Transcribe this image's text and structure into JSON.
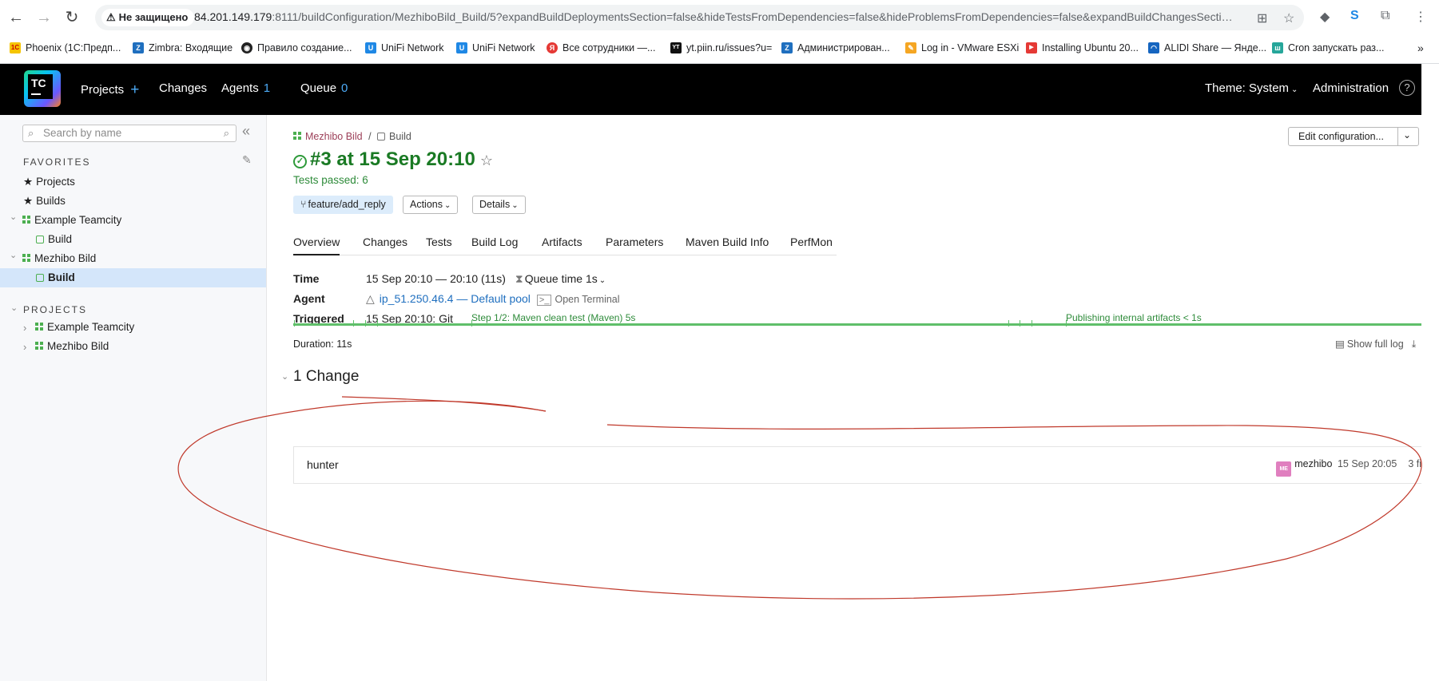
{
  "browser": {
    "insecure_label": "Не защищено",
    "url_host": "84.201.149.179",
    "url_rest": ":8111/buildConfiguration/MezhiboBild_Build/5?expandBuildDeploymentsSection=false&hideTestsFromDependencies=false&hideProblemsFromDependencies=false&expandBuildChangesSection=t...",
    "bookmarks": [
      {
        "label": "Phoenix (1С:Предп...",
        "color": "#f5c400",
        "glyph": "1С"
      },
      {
        "label": "Zimbra: Входящие",
        "color": "#1f6fbf",
        "glyph": "Z"
      },
      {
        "label": "Правило создание...",
        "color": "#222222",
        "glyph": "◉"
      },
      {
        "label": "UniFi Network",
        "color": "#1f88e5",
        "glyph": "U"
      },
      {
        "label": "UniFi Network",
        "color": "#1f88e5",
        "glyph": "U"
      },
      {
        "label": "Все сотрудники —...",
        "color": "#e53935",
        "glyph": "Я"
      },
      {
        "label": "yt.piin.ru/issues?u=",
        "color": "#111111",
        "glyph": "YT"
      },
      {
        "label": "Администрирован...",
        "color": "#1f6fbf",
        "glyph": "Z"
      },
      {
        "label": "Log in - VMware ESXi",
        "color": "#f5a623",
        "glyph": "✎"
      },
      {
        "label": "Installing Ubuntu 20...",
        "color": "#e53935",
        "glyph": "▶"
      },
      {
        "label": "ALIDI Share — Янде...",
        "color": "#1565c0",
        "glyph": "◠"
      },
      {
        "label": "Cron запускать раз...",
        "color": "#26a69a",
        "glyph": "ш"
      }
    ]
  },
  "header": {
    "nav": {
      "projects": "Projects",
      "changes": "Changes",
      "agents": "Agents",
      "agents_count": "1",
      "queue": "Queue",
      "queue_count": "0"
    },
    "theme": "Theme: System",
    "administration": "Administration",
    "logo_text": "TC"
  },
  "sidebar": {
    "search_placeholder": "Search by name",
    "favorites_heading": "FAVORITES",
    "fav_projects": "Projects",
    "fav_builds": "Builds",
    "tree": [
      {
        "label": "Example Teamcity"
      },
      {
        "label": "Build"
      },
      {
        "label": "Mezhibo Bild"
      },
      {
        "label": "Build"
      }
    ],
    "projects_heading": "PROJECTS",
    "projects": [
      {
        "label": "Example Teamcity"
      },
      {
        "label": "Mezhibo Bild"
      }
    ]
  },
  "build": {
    "breadcrumb_project": "Mezhibo Bild",
    "breadcrumb_sep": "/",
    "breadcrumb_config": "Build",
    "title": "#3 at 15 Sep 20:10",
    "tests_passed": "Tests passed: 6",
    "branch": "feature/add_reply",
    "actions": "Actions",
    "details": "Details",
    "edit_config": "Edit configuration...",
    "tabs": [
      "Overview",
      "Changes",
      "Tests",
      "Build Log",
      "Artifacts",
      "Parameters",
      "Maven Build Info",
      "PerfMon"
    ],
    "time_label": "Time",
    "time_value": "15 Sep 20:10 — 20:10 (11s)",
    "queue_time": "Queue time 1s",
    "agent_label": "Agent",
    "agent_name": "ip_51.250.46.4",
    "agent_sep": "—",
    "agent_pool": "Default pool",
    "open_terminal": "Open Terminal",
    "triggered_label": "Triggered",
    "triggered_value": "15 Sep 20:10: Git",
    "step1": "Step 1/2: Maven clean test (Maven) 5s",
    "step2": "Publishing internal artifacts < 1s",
    "duration": "Duration: 11s",
    "show_full_log": "Show full log",
    "changes_heading": "1 Change",
    "change": {
      "message": "hunter",
      "avatar": "ME",
      "author": "mezhibo",
      "date": "15 Sep 20:05",
      "files": "3 fi"
    }
  }
}
